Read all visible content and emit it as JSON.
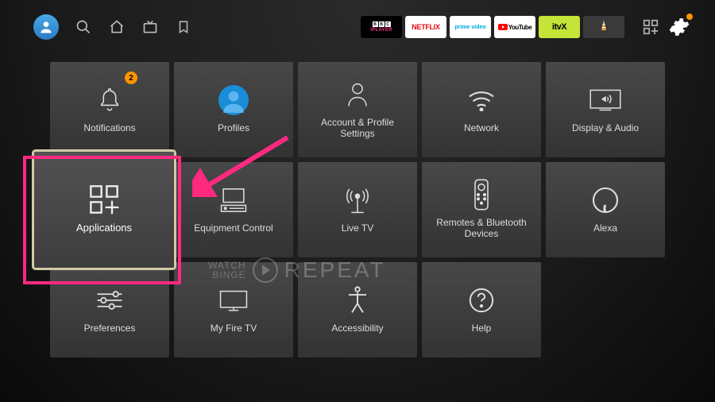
{
  "topbar": {
    "apps": {
      "bbc_label": "iPLAYER",
      "netflix_label": "NETFLIX",
      "prime_label": "prime video",
      "youtube_label": "YouTube",
      "itvx_label": "itvX"
    }
  },
  "tiles": {
    "notifications": {
      "label": "Notifications",
      "badge": "2"
    },
    "profiles": {
      "label": "Profiles"
    },
    "account": {
      "label": "Account & Profile Settings"
    },
    "network": {
      "label": "Network"
    },
    "display": {
      "label": "Display & Audio"
    },
    "applications": {
      "label": "Applications"
    },
    "equipment": {
      "label": "Equipment Control"
    },
    "livetv": {
      "label": "Live TV"
    },
    "remotes": {
      "label": "Remotes & Bluetooth Devices"
    },
    "alexa": {
      "label": "Alexa"
    },
    "preferences": {
      "label": "Preferences"
    },
    "myfiretv": {
      "label": "My Fire TV"
    },
    "accessibility": {
      "label": "Accessibility"
    },
    "help": {
      "label": "Help"
    }
  },
  "watermark": {
    "line1": "WATCH",
    "line2": "BINGE",
    "repeat": "REPEAT"
  }
}
